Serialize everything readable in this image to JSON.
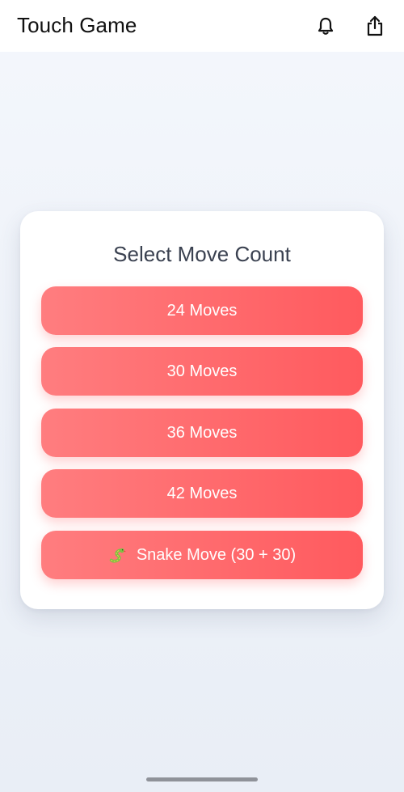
{
  "app_bar": {
    "title": "Touch Game",
    "actions": [
      {
        "icon": "bell-icon"
      },
      {
        "icon": "share-icon"
      }
    ]
  },
  "card": {
    "title": "Select Move Count",
    "options": [
      {
        "label": "24 Moves"
      },
      {
        "label": "30 Moves"
      },
      {
        "label": "36 Moves"
      },
      {
        "label": "42 Moves"
      },
      {
        "label": "Snake Move (30 + 30)",
        "icon": "snake-icon"
      }
    ]
  },
  "colors": {
    "button_gradient_start": "#ff7d7f",
    "button_gradient_end": "#ff5a5e",
    "card_title": "#3a4150",
    "background": "#eef2f9"
  }
}
